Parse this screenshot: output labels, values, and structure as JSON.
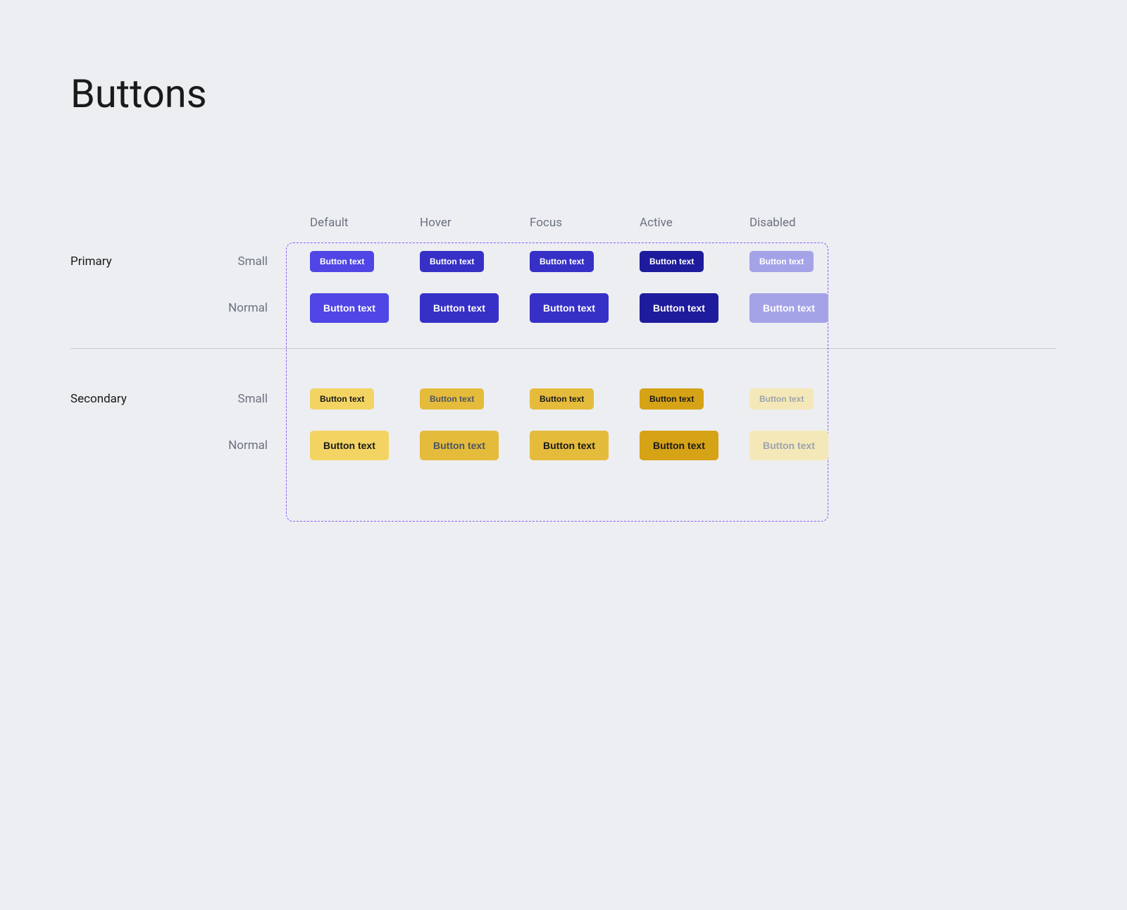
{
  "title": "Buttons",
  "columns": {
    "default": "Default",
    "hover": "Hover",
    "focus": "Focus",
    "active": "Active",
    "disabled": "Disabled"
  },
  "groups": {
    "primary": {
      "label": "Primary",
      "sizes": {
        "small": "Small",
        "normal": "Normal"
      }
    },
    "secondary": {
      "label": "Secondary",
      "sizes": {
        "small": "Small",
        "normal": "Normal"
      }
    }
  },
  "button_text": "Button text"
}
